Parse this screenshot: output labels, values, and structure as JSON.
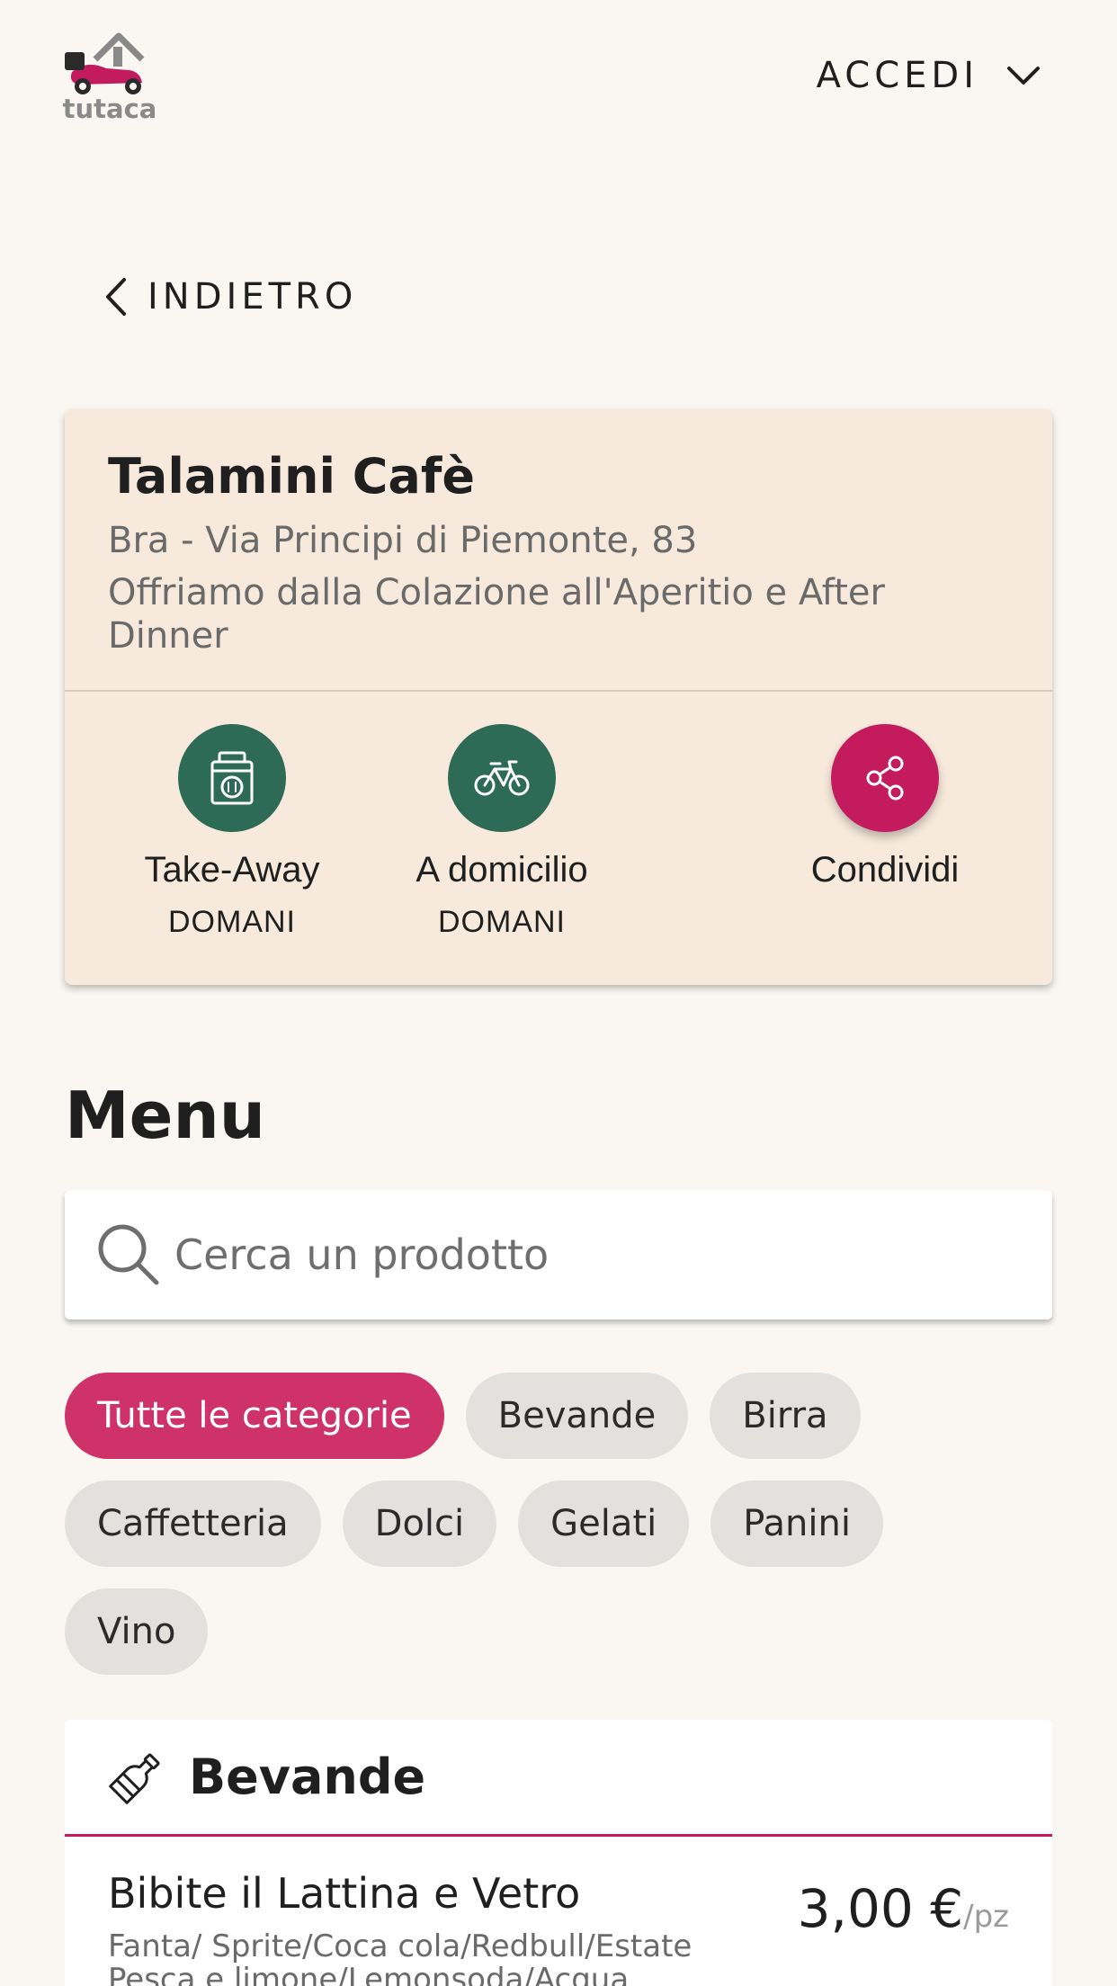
{
  "brand": {
    "logo_text": "tutaca",
    "colors": {
      "accent": "#c41b5e",
      "green": "#2e6b57",
      "card_bg": "#f7eadc",
      "chip_active": "#cf3268"
    }
  },
  "header": {
    "login_label": "ACCEDI",
    "login_icon": "chevron-down-icon"
  },
  "back": {
    "label": "INDIETRO",
    "icon": "chevron-left-icon"
  },
  "shop": {
    "name": "Talamini Cafè",
    "address": "Bra - Via Principi di Piemonte, 83",
    "description": "Offriamo dalla Colazione all'Aperitio e After Dinner",
    "actions": [
      {
        "label": "Take-Away",
        "sub": "DOMANI",
        "icon": "takeaway-bag-icon"
      },
      {
        "label": "A domicilio",
        "sub": "DOMANI",
        "icon": "bicycle-icon"
      },
      {
        "label": "Condividi",
        "icon": "share-icon"
      }
    ]
  },
  "menu": {
    "title": "Menu",
    "search": {
      "placeholder": "Cerca un prodotto",
      "icon": "search-icon"
    },
    "categories": [
      "Tutte le categorie",
      "Bevande",
      "Birra",
      "Caffetteria",
      "Dolci",
      "Gelati",
      "Panini",
      "Vino"
    ],
    "active_category": "Tutte le categorie",
    "sections": [
      {
        "title": "Bevande",
        "icon": "bottle-icon",
        "products": [
          {
            "name": "Bibite il Lattina e Vetro",
            "description": "Fanta/ Sprite/Coca cola/Redbull/Estate Pesca e limone/Lemonsoda/Acqua",
            "price": "3,00 €",
            "unit": "/pz"
          }
        ]
      }
    ]
  }
}
